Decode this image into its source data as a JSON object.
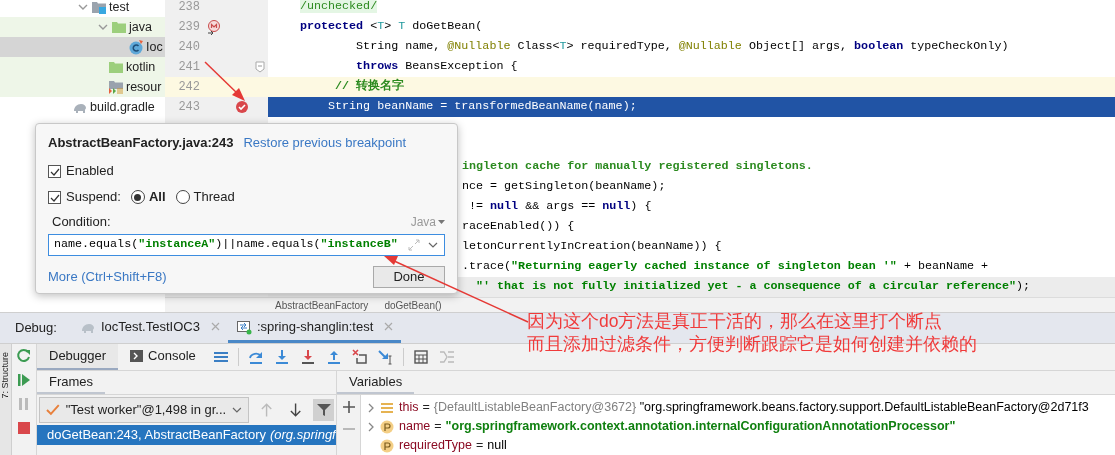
{
  "project_tree": [
    {
      "label": "test",
      "kind": "test-folder",
      "expanded": true,
      "selected": false,
      "children": [
        {
          "label": "java",
          "kind": "source-folder",
          "expanded": true,
          "selected": false,
          "children": [
            {
              "label": "Ioc",
              "kind": "class",
              "selected": true
            }
          ]
        },
        {
          "label": "kotlin",
          "kind": "source-folder",
          "selected": false
        },
        {
          "label": "resour",
          "kind": "resource-folder",
          "selected": false
        }
      ]
    },
    {
      "label": "build.gradle",
      "kind": "gradle",
      "selected": false
    }
  ],
  "editor": {
    "lines": [
      {
        "number": "238",
        "segments": [
          {
            "kind": "suppressed",
            "text": "/unchecked/"
          }
        ]
      },
      {
        "number": "239",
        "override_marker": true,
        "segments": [
          {
            "kind": "keyword",
            "text": "protected"
          },
          {
            "kind": "plain",
            "text": " <"
          },
          {
            "kind": "typeparam",
            "text": "T"
          },
          {
            "kind": "plain",
            "text": "> "
          },
          {
            "kind": "typeparam",
            "text": "T"
          },
          {
            "kind": "plain",
            "text": " doGetBean("
          }
        ]
      },
      {
        "number": "240",
        "segments": [
          {
            "kind": "plain",
            "text": "        String name, "
          },
          {
            "kind": "annotation",
            "text": "@Nullable"
          },
          {
            "kind": "plain",
            "text": " Class<"
          },
          {
            "kind": "typeparam",
            "text": "T"
          },
          {
            "kind": "plain",
            "text": "> requiredType, "
          },
          {
            "kind": "annotation",
            "text": "@Nullable"
          },
          {
            "kind": "plain",
            "text": " Object[] args, "
          },
          {
            "kind": "keyword",
            "text": "boolean"
          },
          {
            "kind": "plain",
            "text": " typeCheckOnly)"
          }
        ]
      },
      {
        "number": "241",
        "fold_marker": true,
        "segments": [
          {
            "kind": "keyword",
            "text": "        throws"
          },
          {
            "kind": "plain",
            "text": " BeansException {"
          }
        ]
      },
      {
        "number": "242",
        "caret_line": true,
        "segments": [
          {
            "kind": "comment",
            "text": "     // 转换名字"
          }
        ]
      },
      {
        "number": "243",
        "execution_point": true,
        "breakpoint": true,
        "segments": [
          {
            "kind": "plain",
            "text": "    String beanName = transformedBeanName(name);"
          }
        ]
      },
      {
        "kind": "hidden"
      },
      {
        "kind": "hidden"
      },
      {
        "clipped_by_popup": true,
        "segments": [
          {
            "kind": "comment",
            "text": "ingleton cache for manually registered singletons."
          }
        ]
      },
      {
        "clipped_by_popup": true,
        "segments": [
          {
            "kind": "plain",
            "text": "nce = getSingleton(beanName);"
          }
        ]
      },
      {
        "clipped_by_popup": true,
        "segments": [
          {
            "kind": "plain",
            "text": " != "
          },
          {
            "kind": "keyword",
            "text": "null"
          },
          {
            "kind": "plain",
            "text": " && args == "
          },
          {
            "kind": "keyword",
            "text": "null"
          },
          {
            "kind": "plain",
            "text": ") {"
          }
        ]
      },
      {
        "clipped_by_popup": true,
        "segments": [
          {
            "kind": "plain",
            "text": "raceEnabled()) {"
          }
        ]
      },
      {
        "clipped_by_popup": true,
        "segments": [
          {
            "kind": "plain",
            "text": "letonCurrentlyInCreation(beanName)) {"
          }
        ]
      },
      {
        "clipped_by_popup": true,
        "segments": [
          {
            "kind": "plain",
            "text": ".trace("
          },
          {
            "kind": "string",
            "text": "\"Returning eagerly cached instance of singleton bean '\""
          },
          {
            "kind": "plain",
            "text": " + beanName +"
          }
        ]
      },
      {
        "hovered": true,
        "clipped_by_popup": true,
        "segments": [
          {
            "kind": "string",
            "text": "  \"' that is not fully initialized yet - a consequence of a circular reference\""
          },
          {
            "kind": "plain",
            "text": ");"
          }
        ]
      }
    ],
    "breadcrumbs": [
      "AbstractBeanFactory",
      "doGetBean()"
    ]
  },
  "breakpoint_popup": {
    "title": "AbstractBeanFactory.java:243",
    "restore_link": "Restore previous breakpoint",
    "enabled": {
      "label": "Enabled",
      "checked": true
    },
    "suspend": {
      "label": "Suspend:",
      "checked": true
    },
    "suspend_options": [
      {
        "label": "All",
        "selected": true
      },
      {
        "label": "Thread",
        "selected": false
      }
    ],
    "condition_label": "Condition:",
    "language": "Java",
    "condition": [
      {
        "kind": "plain",
        "text": "name.equals("
      },
      {
        "kind": "string",
        "text": "\"instanceA\""
      },
      {
        "kind": "plain",
        "text": ")||name.equals("
      },
      {
        "kind": "string",
        "text": "\"instanceB\""
      }
    ],
    "more_link": "More (Ctrl+Shift+F8)",
    "done_button": "Done"
  },
  "annotation": {
    "lines": [
      "因为这个do方法是真正干活的，那么在这里打个断点",
      "而且添加过滤条件，方便判断跟踪它是如何创建并依赖的"
    ]
  },
  "debug": {
    "label": "Debug:",
    "sessions": [
      {
        "label": "IocTest.TestIOC3",
        "kind": "gradle",
        "selected": false
      },
      {
        "label": ":spring-shanglin:test",
        "kind": "run",
        "selected": true
      }
    ],
    "side_tab": "7: Structure",
    "tabs": [
      {
        "label": "Debugger",
        "selected": true
      },
      {
        "label": "Console",
        "selected": false
      }
    ],
    "frames_title": "Frames",
    "variables_title": "Variables",
    "thread": "\"Test worker\"@1,498 in gr...",
    "frames": [
      {
        "method": "doGetBean:243, AbstractBeanFactory",
        "package": "(org.springf",
        "selected": true
      }
    ],
    "variables": [
      {
        "name": "this",
        "kind": "field",
        "expanded": false,
        "operator": "=",
        "type_info": "{DefaultListableBeanFactory@3672}",
        "value": "\"org.springframework.beans.factory.support.DefaultListableBeanFactory@2d71f3",
        "string_value": false
      },
      {
        "name": "name",
        "kind": "param",
        "expanded": false,
        "operator": "=",
        "value": "\"org.springframework.context.annotation.internalConfigurationAnnotationProcessor\"",
        "string_value": true
      },
      {
        "name": "requiredType",
        "kind": "param",
        "operator": "=",
        "value": "null",
        "string_value": false
      }
    ]
  }
}
